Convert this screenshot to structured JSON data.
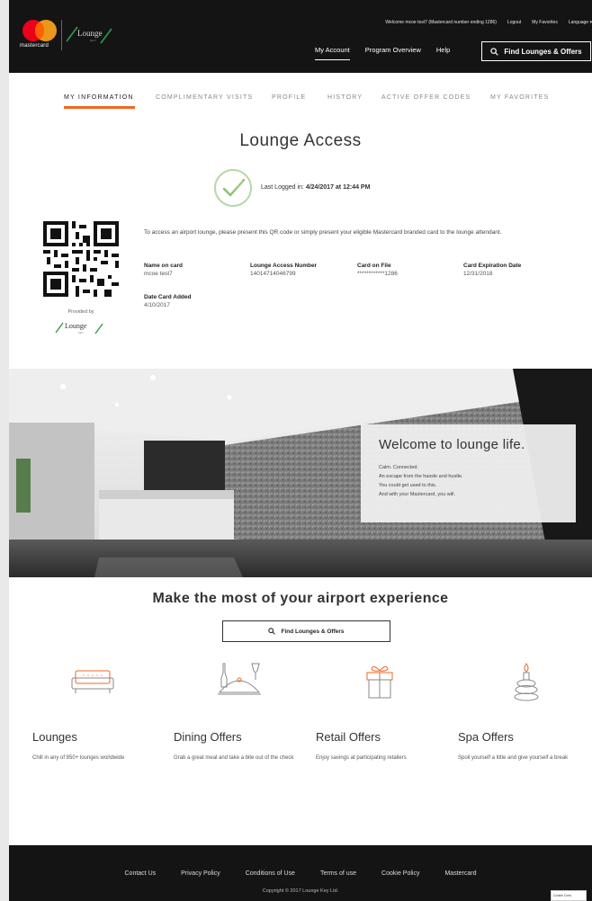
{
  "header": {
    "mc_word": "mastercard",
    "lk_logo": "Lounge",
    "lk_sub": "KEY",
    "util_links": [
      "Welcome mcoe test7 (Mastercard number ending 1286)",
      "Logout",
      "My Favorites",
      "Language ▾"
    ],
    "nav": [
      "My Account",
      "Program Overview",
      "Help"
    ],
    "find_label": "Find Lounges & Offers"
  },
  "tabs": [
    "MY INFORMATION",
    "COMPLIMENTARY VISITS",
    "PROFILE",
    "HISTORY",
    "ACTIVE OFFER CODES",
    "MY FAVORITES"
  ],
  "title": "Lounge Access",
  "last_logged": {
    "label": "Last Logged in:",
    "value": "4/24/2017 at 12:44 PM"
  },
  "intro": "To access an airport lounge, please present this QR code or simply present your eligible Mastercard branded card to the lounge attendant.",
  "provided_by": "Provided by",
  "fields": {
    "name_label": "Name on card",
    "name_value": "mcoe test7",
    "lan_label": "Lounge Access Number",
    "lan_value": "14014714046799",
    "card_label": "Card on File",
    "card_value": "************1286",
    "exp_label": "Card Expiration Date",
    "exp_value": "12/31/2018",
    "added_label": "Date Card Added",
    "added_value": "4/10/2017"
  },
  "hero": {
    "heading": "Welcome to lounge life.",
    "lines": [
      "Calm. Connected.",
      "An escape from the hassle and hustle.",
      "You could get used to this.",
      "And with your Mastercard, you will."
    ]
  },
  "sub_title": "Make the most of your airport experience",
  "find_btn2": "Find Lounges & Offers",
  "features": [
    {
      "name": "Lounges",
      "desc": "Chill in any of 850+ lounges worldwide",
      "icon": "sofa-icon"
    },
    {
      "name": "Dining Offers",
      "desc": "Grab a great meal and take a bite out of the check",
      "icon": "dining-icon"
    },
    {
      "name": "Retail Offers",
      "desc": "Enjoy savings at participating retailers",
      "icon": "gift-icon"
    },
    {
      "name": "Spa Offers",
      "desc": "Spoil yourself a little and give yourself a break",
      "icon": "spa-stones-icon"
    }
  ],
  "footer": {
    "links": [
      "Contact Us",
      "Privacy Policy",
      "Conditions of Use",
      "Terms of use",
      "Cookie Policy",
      "Mastercard"
    ],
    "copyright": "Copyright © 2017 Lounge Key Ltd."
  },
  "cookie_tab": "Cookie Cons",
  "colors": {
    "accent": "#f26522",
    "header_bg": "#141414",
    "check_green": "#b6d7a8"
  }
}
